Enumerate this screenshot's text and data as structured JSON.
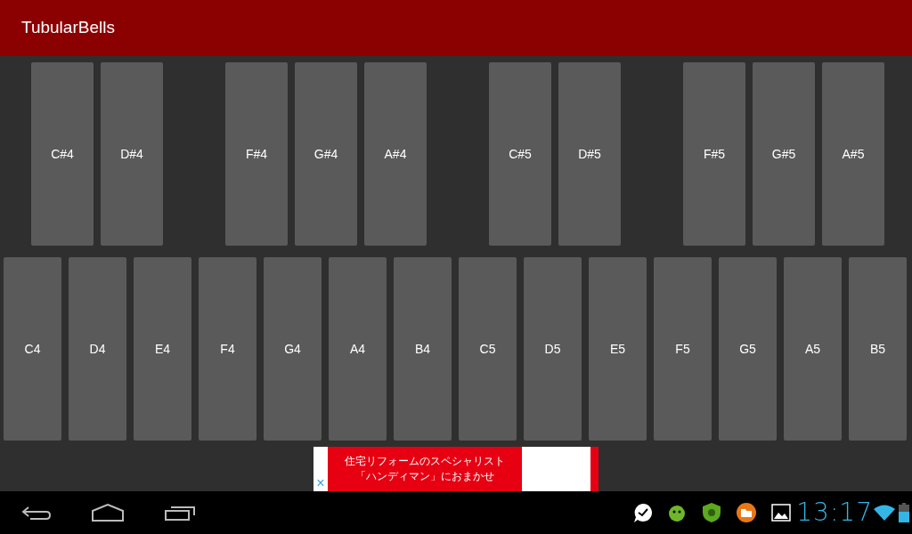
{
  "app_bar": {
    "title": "TubularBells"
  },
  "sharp_groups": [
    [
      "C#4",
      "D#4"
    ],
    [
      "F#4",
      "G#4",
      "A#4"
    ],
    [
      "C#5",
      "D#5"
    ],
    [
      "F#5",
      "G#5",
      "A#5"
    ]
  ],
  "natural_keys": [
    "C4",
    "D4",
    "E4",
    "F4",
    "G4",
    "A4",
    "B4",
    "C5",
    "D5",
    "E5",
    "F5",
    "G5",
    "A5",
    "B5"
  ],
  "ad": {
    "lines": [
      "住宅リフォームのスペシャリスト",
      "「ハンディマン」におまかせ"
    ],
    "close": "×"
  },
  "status_bar": {
    "time": "13:17"
  }
}
